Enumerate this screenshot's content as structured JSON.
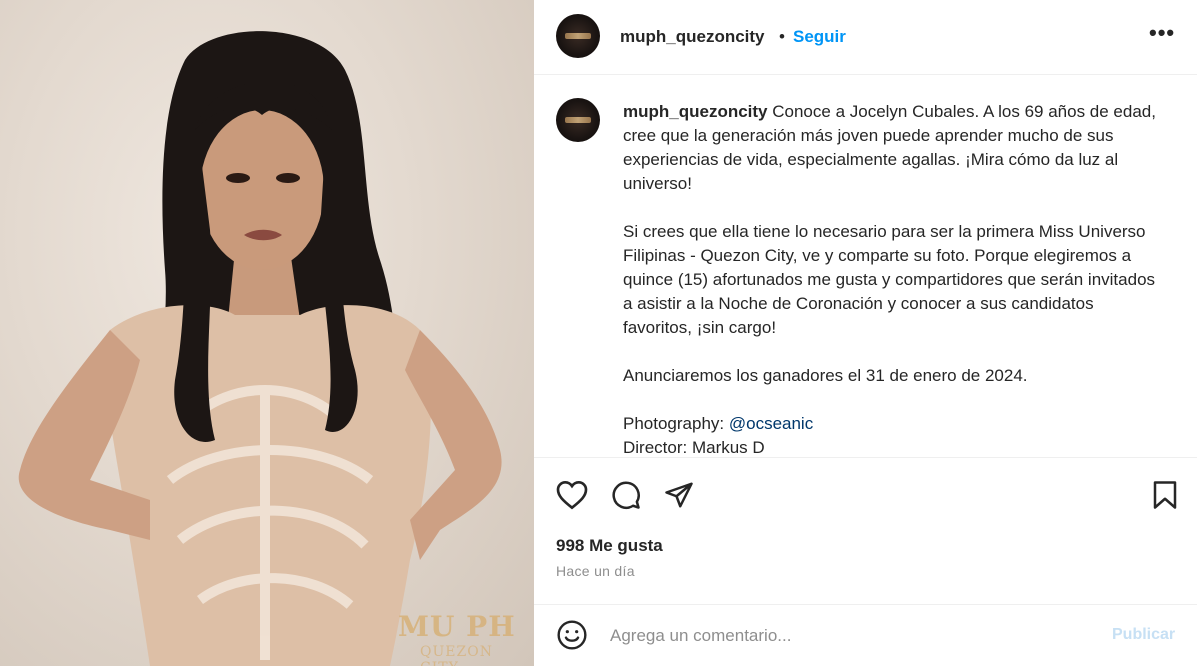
{
  "post": {
    "watermark": "MU PH",
    "watermark_sub": "QUEZON CITY"
  },
  "header": {
    "username": "muph_quezoncity",
    "separator": "•",
    "follow_label": "Seguir",
    "more_label": "•••"
  },
  "caption": {
    "username": "muph_quezoncity",
    "paragraph1": "Conoce a Jocelyn Cubales. A los 69 años de edad, cree que la generación más joven puede aprender mucho de sus experiencias de vida, especialmente agallas. ¡Mira cómo da luz al universo!",
    "paragraph2": "Si crees que ella tiene lo necesario para ser la primera Miss Universo Filipinas - Quezon City, ve y comparte su foto. Porque elegiremos a quince (15) afortunados me gusta y compartidores que serán invitados a asistir a la Noche de Coronación y conocer a sus candidatos favoritos, ¡sin cargo!",
    "paragraph3": "Anunciaremos los ganadores el 31 de enero de 2024.",
    "credit1_label": "Photography: ",
    "credit1_handle": "@ocseanic",
    "credit2": "Director: Markus D"
  },
  "actions": {
    "like_icon": "heart-icon",
    "comment_icon": "comment-icon",
    "share_icon": "send-icon",
    "save_icon": "bookmark-icon"
  },
  "stats": {
    "likes": "998 Me gusta",
    "time": "Hace un día"
  },
  "comment_box": {
    "emoji_icon": "emoji-icon",
    "placeholder": "Agrega un comentario...",
    "publish_label": "Publicar"
  },
  "colors": {
    "accent": "#0095f6",
    "publish_disabled": "#c7e0f4",
    "secondary_text": "#8e8e8e"
  }
}
